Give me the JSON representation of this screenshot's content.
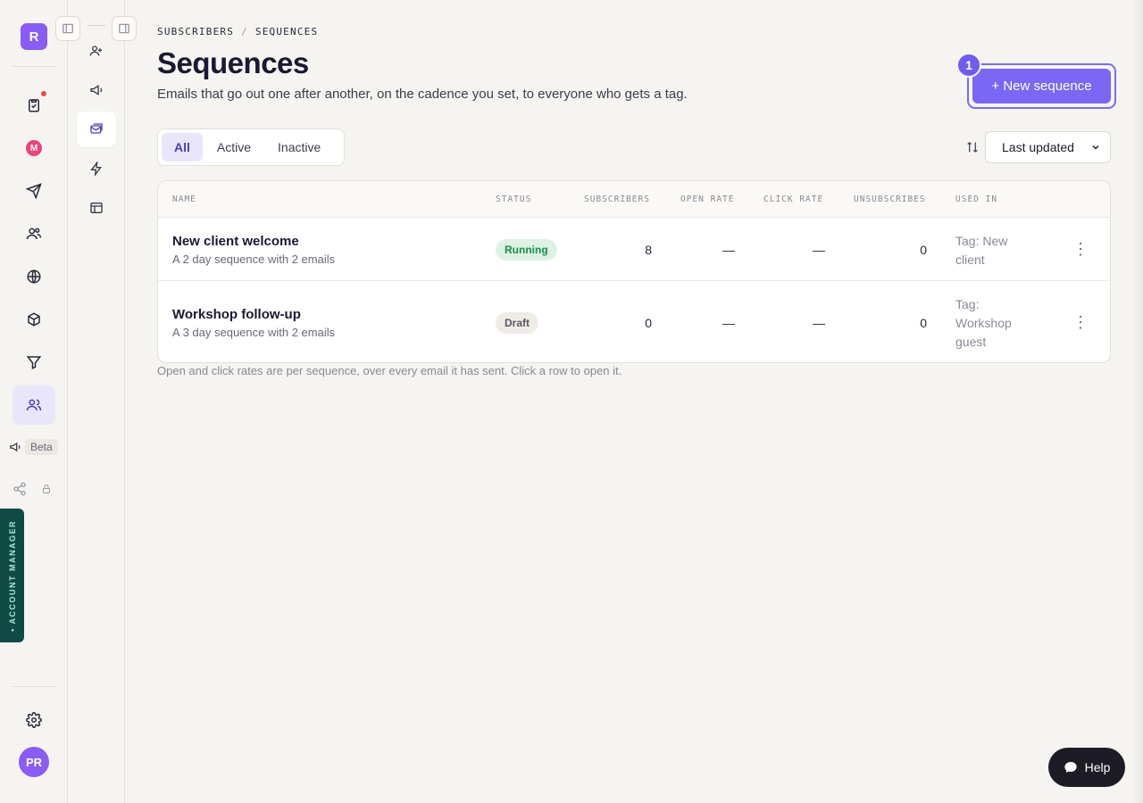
{
  "rail": {
    "logo_letter": "R",
    "m_badge": "M",
    "beta_label": "Beta",
    "account_manager_label": "• ACCOUNT MANAGER",
    "avatar_initials": "PR"
  },
  "breadcrumb": {
    "parent": "SUBSCRIBERS",
    "separator": "/",
    "current": "SEQUENCES"
  },
  "header": {
    "title": "Sequences",
    "subtitle": "Emails that go out one after another, on the cadence you set, to everyone who gets a tag.",
    "new_button_label": "+ New sequence",
    "step_badge": "1"
  },
  "filters": {
    "tabs": [
      "All",
      "Active",
      "Inactive"
    ],
    "active_tab": "All"
  },
  "sort": {
    "selected": "Last updated"
  },
  "table": {
    "columns": [
      "NAME",
      "STATUS",
      "SUBSCRIBERS",
      "OPEN RATE",
      "CLICK RATE",
      "UNSUBSCRIBES",
      "USED IN"
    ],
    "rows": [
      {
        "name": "New client welcome",
        "description": "A 2 day sequence with 2 emails",
        "status": "Running",
        "subscribers": "8",
        "open_rate": "—",
        "click_rate": "—",
        "unsubscribes": "0",
        "used_in": "Tag: New client",
        "menu": "⋮"
      },
      {
        "name": "Workshop follow-up",
        "description": "A 3 day sequence with 2 emails",
        "status": "Draft",
        "subscribers": "0",
        "open_rate": "—",
        "click_rate": "—",
        "unsubscribes": "0",
        "used_in": "Tag: Workshop guest",
        "menu": "⋮"
      }
    ]
  },
  "footnote": "Open and click rates are per sequence, over every email it has sent. Click a row to open it.",
  "help": {
    "label": "Help"
  },
  "colors": {
    "accent": "#7a68f5",
    "running": "#1f8a4c",
    "rail_active": "#e9e6fb",
    "account_manager": "#0f4a45"
  }
}
